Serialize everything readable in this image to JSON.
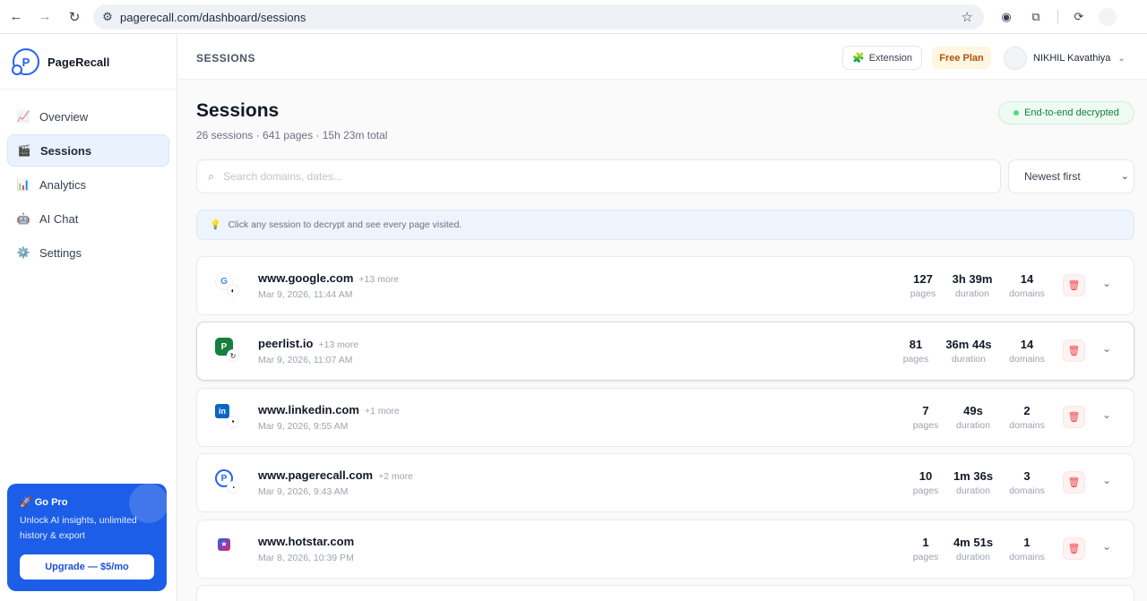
{
  "browser": {
    "url": "pagerecall.com/dashboard/sessions"
  },
  "sidebar": {
    "brand": "PageRecall",
    "items": [
      {
        "label": "Overview",
        "icon": "📈",
        "active": false
      },
      {
        "label": "Sessions",
        "icon": "🎬",
        "active": true
      },
      {
        "label": "Analytics",
        "icon": "📊",
        "active": false
      },
      {
        "label": "AI Chat",
        "icon": "🤖",
        "active": false
      },
      {
        "label": "Settings",
        "icon": "⚙️",
        "active": false
      }
    ],
    "pro": {
      "title": "🚀 Go Pro",
      "desc": "Unlock AI insights, unlimited history & export",
      "button": "Upgrade — $5/mo"
    }
  },
  "topbar": {
    "crumb": "SESSIONS",
    "extension": "Extension",
    "plan": "Free Plan",
    "user": "NIKHIL Kavathiya"
  },
  "page": {
    "title": "Sessions",
    "subtitle": "26 sessions · 641 pages · 15h 23m total",
    "e2e": "End-to-end decrypted",
    "search_placeholder": "Search domains, dates...",
    "sort": "Newest first",
    "tip": "Click any session to decrypt and see every page visited."
  },
  "labels": {
    "pages": "pages",
    "duration": "duration",
    "domains": "domains"
  },
  "sessions": [
    {
      "domain": "www.google.com",
      "more": "+13 more",
      "date": "Mar 9, 2026, 11:44 AM",
      "pages": "127",
      "duration": "3h 39m",
      "domains": "14",
      "fav": "G",
      "favColor": "#4285f4"
    },
    {
      "domain": "peerlist.io",
      "more": "+13 more",
      "date": "Mar 9, 2026, 11:07 AM",
      "pages": "81",
      "duration": "36m 44s",
      "domains": "14",
      "fav": "P",
      "favColor": "#15803d"
    },
    {
      "domain": "www.linkedin.com",
      "more": "+1 more",
      "date": "Mar 9, 2026, 9:55 AM",
      "pages": "7",
      "duration": "49s",
      "domains": "2",
      "fav": "in",
      "favColor": "#0a66c2"
    },
    {
      "domain": "www.pagerecall.com",
      "more": "+2 more",
      "date": "Mar 9, 2026, 9:43 AM",
      "pages": "10",
      "duration": "1m 36s",
      "domains": "3",
      "fav": "P",
      "favColor": "#2563eb"
    },
    {
      "domain": "www.hotstar.com",
      "more": "",
      "date": "Mar 8, 2026, 10:39 PM",
      "pages": "1",
      "duration": "4m 51s",
      "domains": "1",
      "fav": "★",
      "favColor": "#7c3aed"
    }
  ]
}
